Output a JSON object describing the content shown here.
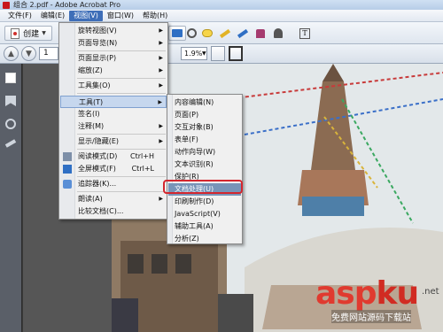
{
  "window": {
    "title": "组合 2.pdf - Adobe Acrobat Pro"
  },
  "menubar": {
    "items": [
      {
        "label": "文件(F)"
      },
      {
        "label": "编辑(E)"
      },
      {
        "label": "视图(V)",
        "active": true
      },
      {
        "label": "窗口(W)"
      },
      {
        "label": "帮助(H)"
      }
    ]
  },
  "toolbar": {
    "create_label": "创建",
    "page_number": "1",
    "zoom_value": "1.9%",
    "icons": [
      "create-icon",
      "print-icon",
      "settings-icon",
      "comment-icon",
      "highlight-icon",
      "sign-icon",
      "stamp-icon",
      "user-icon",
      "text-icon"
    ]
  },
  "view_menu": {
    "items": [
      {
        "label": "旋转视图(V)",
        "submenu": true
      },
      {
        "label": "页面导览(N)",
        "submenu": true
      },
      {
        "label": "页面显示(P)",
        "submenu": true
      },
      {
        "label": "缩放(Z)",
        "submenu": true
      },
      {
        "label": "工具集(O)",
        "submenu": true
      },
      {
        "label": "工具(T)",
        "submenu": true,
        "highlighted": true
      },
      {
        "label": "签名(I)"
      },
      {
        "label": "注释(M)",
        "submenu": true
      },
      {
        "label": "显示/隐藏(E)",
        "submenu": true
      },
      {
        "label": "阅读模式(D)",
        "shortcut": "Ctrl+H"
      },
      {
        "label": "全屏模式(F)",
        "shortcut": "Ctrl+L"
      },
      {
        "label": "追踪器(K)..."
      },
      {
        "label": "朗读(A)",
        "submenu": true
      },
      {
        "label": "比较文档(C)..."
      }
    ]
  },
  "tools_submenu": {
    "items": [
      {
        "label": "内容编辑(N)"
      },
      {
        "label": "页面(P)"
      },
      {
        "label": "交互对象(B)"
      },
      {
        "label": "表单(F)"
      },
      {
        "label": "动作向导(W)"
      },
      {
        "label": "文本识别(R)"
      },
      {
        "label": "保护(R)"
      },
      {
        "label": "文档处理(U)",
        "circled": true
      },
      {
        "label": "印刷制作(D)"
      },
      {
        "label": "JavaScript(V)"
      },
      {
        "label": "辅助工具(A)"
      },
      {
        "label": "分析(Z)"
      }
    ]
  },
  "watermark": {
    "logo_main": "asp",
    "logo_ku": "ku",
    "subtitle": "免费网站源码下载站",
    "suffix": ".net"
  },
  "colors": {
    "menu_active": "#3e6eb8",
    "highlight_row": "#c6d7ee",
    "annotation_red": "#d4262e"
  }
}
